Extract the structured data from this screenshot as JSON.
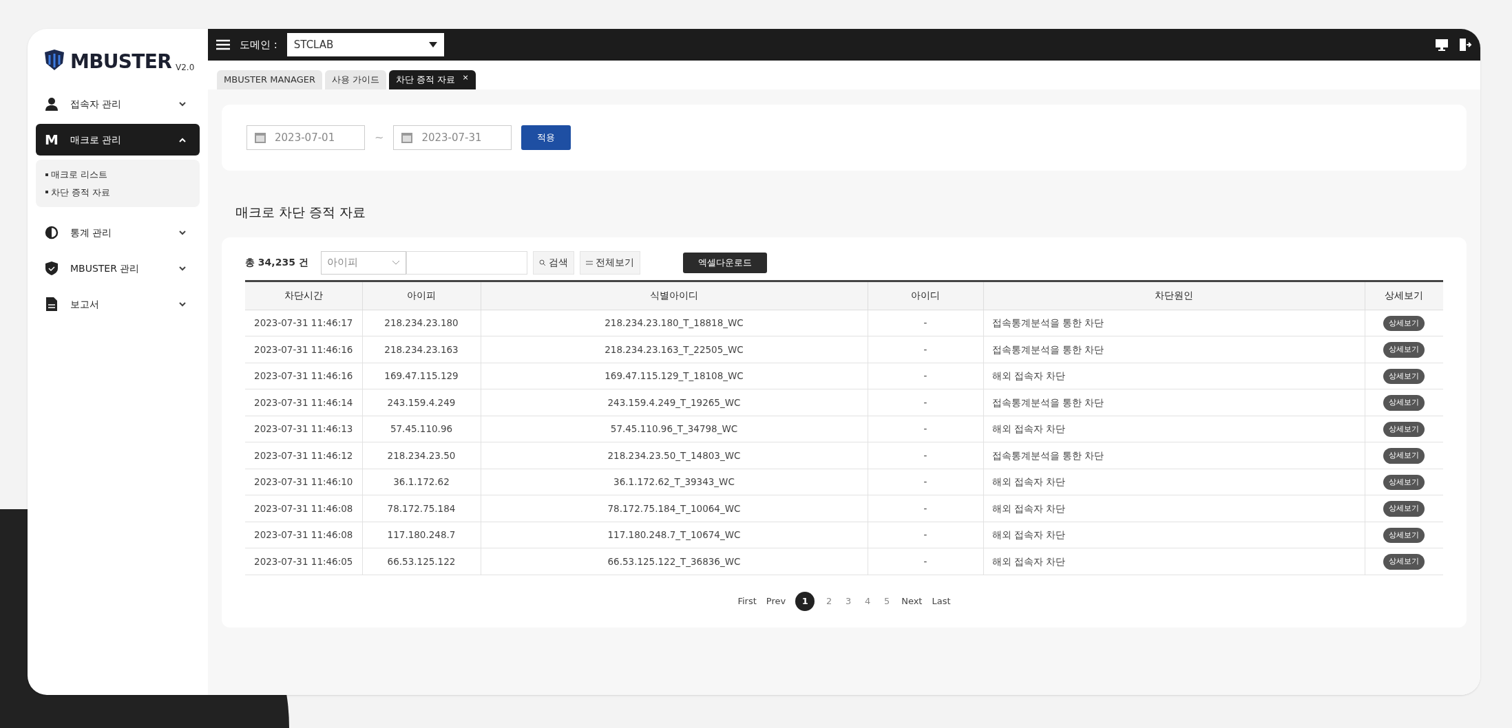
{
  "brand": {
    "name": "MBUSTER",
    "version": "V2.0"
  },
  "sidebar": {
    "items": [
      {
        "kind": "user",
        "label": "접속자 관리",
        "expanded": false
      },
      {
        "kind": "letter",
        "letter": "M",
        "label": "매크로 관리",
        "expanded": true,
        "children": [
          {
            "label": "매크로 리스트"
          },
          {
            "label": "차단 증적 자료"
          }
        ]
      },
      {
        "kind": "chart",
        "label": "통계 관리",
        "expanded": false
      },
      {
        "kind": "shield",
        "label": "MBUSTER 관리",
        "expanded": false
      },
      {
        "kind": "doc",
        "label": "보고서",
        "expanded": false
      }
    ]
  },
  "topbar": {
    "domain_label": "도메인 :",
    "domain_value": "STCLAB"
  },
  "tabs": [
    {
      "label": "MBUSTER MANAGER",
      "selected": false
    },
    {
      "label": "사용 가이드",
      "selected": false
    },
    {
      "label": "차단 증적 자료",
      "selected": true,
      "close": "×"
    }
  ],
  "date_filter": {
    "start": "2023-07-01",
    "separator": "~",
    "end": "2023-07-31",
    "apply": "적용"
  },
  "section_title": "매크로 차단 증적 자료",
  "toolbar": {
    "total": "총 34,235 건",
    "filter_select": "아이피",
    "search": "검색",
    "show_all": "전체보기",
    "excel": "엑셀다운로드"
  },
  "table": {
    "columns": [
      "차단시간",
      "아이피",
      "식별아이디",
      "아이디",
      "차단원인",
      "상세보기"
    ],
    "rows": [
      [
        "2023-07-31 11:46:17",
        "218.234.23.180",
        "218.234.23.180_T_18818_WC",
        "-",
        "접속통계분석을 통한 차단",
        "상세보기"
      ],
      [
        "2023-07-31 11:46:16",
        "218.234.23.163",
        "218.234.23.163_T_22505_WC",
        "-",
        "접속통계분석을 통한 차단",
        "상세보기"
      ],
      [
        "2023-07-31 11:46:16",
        "169.47.115.129",
        "169.47.115.129_T_18108_WC",
        "-",
        "해외 접속자 차단",
        "상세보기"
      ],
      [
        "2023-07-31 11:46:14",
        "243.159.4.249",
        "243.159.4.249_T_19265_WC",
        "-",
        "접속통계분석을 통한 차단",
        "상세보기"
      ],
      [
        "2023-07-31 11:46:13",
        "57.45.110.96",
        "57.45.110.96_T_34798_WC",
        "-",
        "해외 접속자 차단",
        "상세보기"
      ],
      [
        "2023-07-31 11:46:12",
        "218.234.23.50",
        "218.234.23.50_T_14803_WC",
        "-",
        "접속통계분석을 통한 차단",
        "상세보기"
      ],
      [
        "2023-07-31 11:46:10",
        "36.1.172.62",
        "36.1.172.62_T_39343_WC",
        "-",
        "해외 접속자 차단",
        "상세보기"
      ],
      [
        "2023-07-31 11:46:08",
        "78.172.75.184",
        "78.172.75.184_T_10064_WC",
        "-",
        "해외 접속자 차단",
        "상세보기"
      ],
      [
        "2023-07-31 11:46:08",
        "117.180.248.7",
        "117.180.248.7_T_10674_WC",
        "-",
        "해외 접속자 차단",
        "상세보기"
      ],
      [
        "2023-07-31 11:46:05",
        "66.53.125.122",
        "66.53.125.122_T_36836_WC",
        "-",
        "해외 접속자 차단",
        "상세보기"
      ]
    ]
  },
  "pagination": {
    "first": "First",
    "prev": "Prev",
    "pages": [
      {
        "label": "1",
        "selected": true
      },
      {
        "label": "2",
        "selected": false
      },
      {
        "label": "3",
        "selected": false
      },
      {
        "label": "4",
        "selected": false
      },
      {
        "label": "5",
        "selected": false
      }
    ],
    "next": "Next",
    "last": "Last"
  }
}
